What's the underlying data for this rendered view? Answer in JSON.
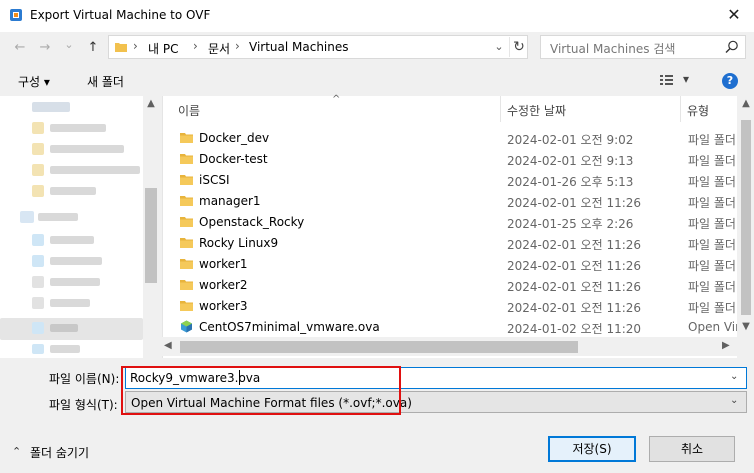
{
  "window": {
    "title": "Export Virtual Machine to OVF",
    "close_glyph": "✕"
  },
  "nav": {
    "back": "←",
    "forward": "→",
    "recent": "⌄",
    "up": "↑",
    "breadcrumb": [
      "내 PC",
      "문서",
      "Virtual Machines"
    ],
    "separator": "›",
    "dropdown": "⌄",
    "refresh": "↻",
    "search_placeholder": "Virtual Machines 검색"
  },
  "toolbar": {
    "organize": "구성 ▾",
    "new_folder": "새 폴더",
    "view": "▾",
    "help": "?"
  },
  "columns": {
    "name": "이름",
    "date": "수정한 날짜",
    "type": "유형",
    "sort_indicator": "^"
  },
  "files": [
    {
      "name": "Docker_dev",
      "date": "2024-02-01 오전 9:02",
      "type": "파일 폴더",
      "icon": "folder-icon"
    },
    {
      "name": "Docker-test",
      "date": "2024-02-01 오전 9:13",
      "type": "파일 폴더",
      "icon": "folder-icon"
    },
    {
      "name": "iSCSI",
      "date": "2024-01-26 오후 5:13",
      "type": "파일 폴더",
      "icon": "folder-icon"
    },
    {
      "name": "manager1",
      "date": "2024-02-01 오전 11:26",
      "type": "파일 폴더",
      "icon": "folder-icon"
    },
    {
      "name": "Openstack_Rocky",
      "date": "2024-01-25 오후 2:26",
      "type": "파일 폴더",
      "icon": "folder-icon"
    },
    {
      "name": "Rocky Linux9",
      "date": "2024-02-01 오전 11:26",
      "type": "파일 폴더",
      "icon": "folder-icon"
    },
    {
      "name": "worker1",
      "date": "2024-02-01 오전 11:26",
      "type": "파일 폴더",
      "icon": "folder-icon"
    },
    {
      "name": "worker2",
      "date": "2024-02-01 오전 11:26",
      "type": "파일 폴더",
      "icon": "folder-icon"
    },
    {
      "name": "worker3",
      "date": "2024-02-01 오전 11:26",
      "type": "파일 폴더",
      "icon": "folder-icon"
    },
    {
      "name": "CentOS7minimal_vmware.ova",
      "date": "2024-01-02 오전 11:20",
      "type": "Open Vir",
      "icon": "ova-file-icon"
    }
  ],
  "form": {
    "filename_label": "파일 이름(N):",
    "filename_value": "Rocky9_vmware3.ova",
    "filetype_label": "파일 형식(T):",
    "filetype_value": "Open Virtual Machine Format files (*.ovf;*.ova)"
  },
  "footer": {
    "hide_folders": "폴더 숨기기",
    "save": "저장(S)",
    "cancel": "취소"
  },
  "colors": {
    "accent": "#0078d7",
    "highlight": "#e01010",
    "folder": "#f2c14e"
  }
}
